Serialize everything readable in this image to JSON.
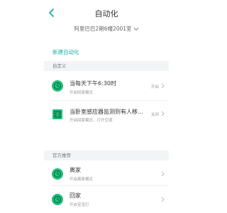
{
  "header": {
    "title": "自动化",
    "home_selector": "阿里巴巴2期6幢2001室"
  },
  "new_automation_label": "新建自动化",
  "sections": {
    "custom": "自定义",
    "official": "官方推荐"
  },
  "automations": [
    {
      "name": "当每天下午6:30时",
      "sub": "开启回家模式",
      "status": "开启"
    },
    {
      "name": "当卧室感应器监测到有人移...",
      "sub": "开启回家模式，打开空调",
      "status": "关闭"
    }
  ],
  "recommended": [
    {
      "name": "离家",
      "sub": "开启离家模式"
    },
    {
      "name": "回家",
      "sub": "开启宝宝灯"
    }
  ],
  "colors": {
    "accent": "#16b1a3",
    "icon_bg": "#1fbf7a"
  },
  "icons": [
    "back-icon",
    "chevron-down-icon",
    "clock-icon",
    "sensor-icon",
    "chevron-right-icon"
  ]
}
